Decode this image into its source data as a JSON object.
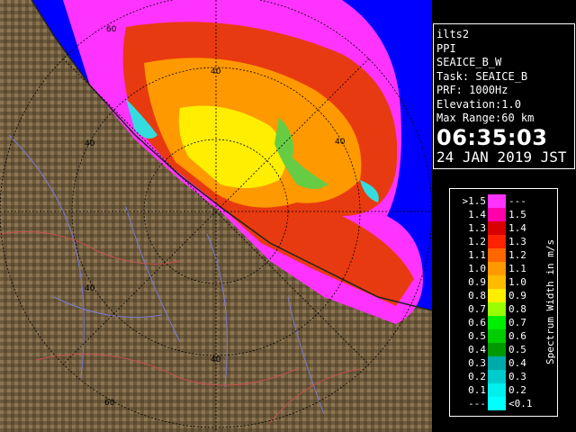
{
  "radar_info": {
    "lines": [
      "ilts2",
      "PPI",
      "SEAICE_B_W",
      "Task: SEAICE_B",
      "PRF: 1000Hz",
      "Elevation:1.0",
      "Max Range:60 km"
    ],
    "time": "06:35:03",
    "date": "24 JAN 2019 JST"
  },
  "legend": {
    "title": "Spectrum Width in m/s",
    "rows": [
      {
        "lo": ">1.5",
        "hi": "---",
        "color": "#ff33ff"
      },
      {
        "lo": "1.4",
        "hi": "1.5",
        "color": "#ff00aa"
      },
      {
        "lo": "1.3",
        "hi": "1.4",
        "color": "#d80000"
      },
      {
        "lo": "1.2",
        "hi": "1.3",
        "color": "#ff2200"
      },
      {
        "lo": "1.1",
        "hi": "1.2",
        "color": "#ff6600"
      },
      {
        "lo": "1.0",
        "hi": "1.1",
        "color": "#ff9900"
      },
      {
        "lo": "0.9",
        "hi": "1.0",
        "color": "#ffbb00"
      },
      {
        "lo": "0.8",
        "hi": "0.9",
        "color": "#ffee00"
      },
      {
        "lo": "0.7",
        "hi": "0.8",
        "color": "#99ff00"
      },
      {
        "lo": "0.6",
        "hi": "0.7",
        "color": "#00ee00"
      },
      {
        "lo": "0.5",
        "hi": "0.6",
        "color": "#00cc00"
      },
      {
        "lo": "0.4",
        "hi": "0.5",
        "color": "#009900"
      },
      {
        "lo": "0.3",
        "hi": "0.4",
        "color": "#00aaaa"
      },
      {
        "lo": "0.2",
        "hi": "0.3",
        "color": "#00cccc"
      },
      {
        "lo": "0.1",
        "hi": "0.2",
        "color": "#00eeee"
      },
      {
        "lo": "---",
        "hi": "<0.1",
        "color": "#00ffff"
      }
    ]
  },
  "map": {
    "range_ring_labels": [
      {
        "text": "60"
      },
      {
        "text": "40"
      },
      {
        "text": "40"
      },
      {
        "text": "40"
      },
      {
        "text": "40"
      },
      {
        "text": "40"
      },
      {
        "text": "60"
      }
    ],
    "colors": {
      "sea": "#0000ff",
      "land": "#6e5a3c",
      "land_light": "#a08a66",
      "rings": "#000000"
    }
  }
}
